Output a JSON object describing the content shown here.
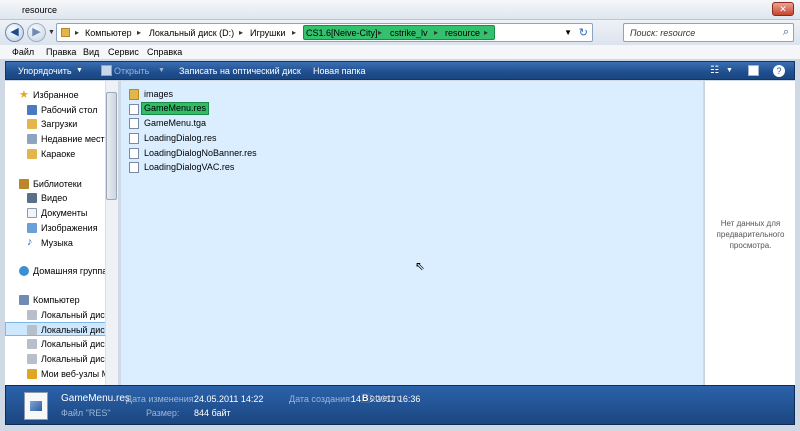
{
  "window": {
    "title": "resource",
    "close_glyph": "✕"
  },
  "nav": {
    "back_glyph": "◀",
    "forward_glyph": "▶"
  },
  "address": {
    "crumbs": [
      "Компьютер",
      "Локальный диск (D:)",
      "Игрушки",
      "CS1.6[Neive-City]",
      "cstrike_lv",
      "resource"
    ],
    "highlight_color": "#33c16d"
  },
  "search": {
    "placeholder": "Поиск: resource"
  },
  "menu": [
    "Файл",
    "Правка",
    "Вид",
    "Сервис",
    "Справка"
  ],
  "toolbar": {
    "organize": "Упорядочить",
    "open": "Открыть",
    "burn": "Записать на оптический диск",
    "new_folder": "Новая папка"
  },
  "sidebar": {
    "favorites_header": "Избранное",
    "favorites": [
      "Рабочий стол",
      "Загрузки",
      "Недавние места",
      "Караоке"
    ],
    "libraries_header": "Библиотеки",
    "libraries": [
      "Видео",
      "Документы",
      "Изображения",
      "Музыка"
    ],
    "homegroup": "Домашняя группа",
    "computer_header": "Компьютер",
    "drives": [
      "Локальный диск",
      "Локальный диск",
      "Локальный диск",
      "Локальный диск",
      "Мои веб-узлы M"
    ]
  },
  "files": [
    {
      "name": "images",
      "type": "folder",
      "selected": false
    },
    {
      "name": "GameMenu.res",
      "type": "res",
      "selected": true
    },
    {
      "name": "GameMenu.tga",
      "type": "tga",
      "selected": false
    },
    {
      "name": "LoadingDialog.res",
      "type": "res",
      "selected": false
    },
    {
      "name": "LoadingDialogNoBanner.res",
      "type": "res",
      "selected": false
    },
    {
      "name": "LoadingDialogVAC.res",
      "type": "res",
      "selected": false
    }
  ],
  "preview": {
    "message": "Нет данных для предварительного просмотра."
  },
  "details": {
    "filename": "GameMenu.res",
    "modified_label": "Дата изменения:",
    "modified_value": "24.05.2011 14:22",
    "created_label": "Дата создания:",
    "created_value": "14.05.2011 16:36",
    "type_label": "Файл \"RES\"",
    "size_label": "Размер:",
    "size_value": "844 байт"
  },
  "watermark": {
    "brand_letter": "B",
    "brand_rest": "otvet.ru"
  },
  "colors": {
    "accent_blue": "#1f4f8f",
    "selection_green": "#2fbd68",
    "list_bg": "#dbeeff"
  }
}
